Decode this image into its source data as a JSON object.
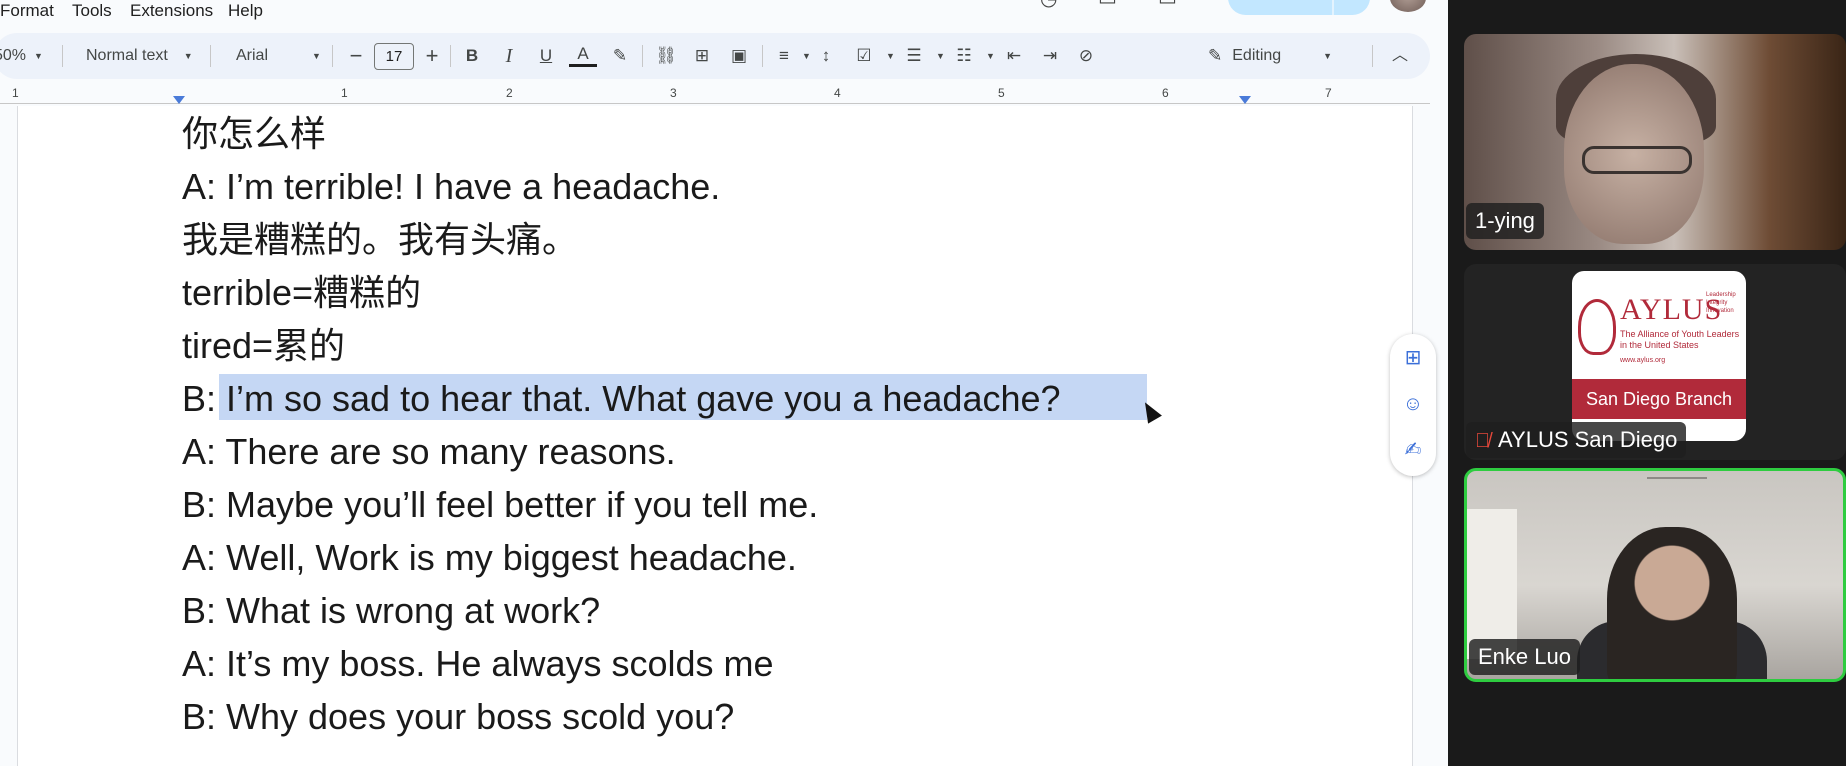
{
  "menubar": {
    "items": [
      "Format",
      "Tools",
      "Extensions",
      "Help"
    ]
  },
  "toolbar": {
    "zoom": "50%",
    "style": "Normal text",
    "font": "Arial",
    "font_size": "17",
    "mode": "Editing",
    "icons": [
      "decrease-font-icon",
      "increase-font-icon",
      "bold-icon",
      "italic-icon",
      "underline-icon",
      "text-color-icon",
      "highlight-icon",
      "link-icon",
      "add-comment-icon",
      "insert-image-icon",
      "align-icon",
      "line-spacing-icon",
      "checklist-icon",
      "bullet-list-icon",
      "numbered-list-icon",
      "decrease-indent-icon",
      "increase-indent-icon",
      "clear-formatting-icon",
      "pencil-icon",
      "collapse-icon"
    ]
  },
  "ruler": {
    "numbers": [
      "1",
      "1",
      "2",
      "3",
      "4",
      "5",
      "6",
      "7"
    ]
  },
  "document": {
    "lines": [
      "你怎么样",
      "A: I’m terrible! I have a headache.",
      "我是糟糕的。我有头痛。",
      "terrible=糟糕的",
      "tired=累的",
      "B: I’m so sad to hear that. What gave you a headache?",
      "A: There are so many reasons.",
      "B: Maybe you’ll feel better if you tell me.",
      "A: Well, Work is my biggest headache.",
      "B: What is wrong at work?",
      "A: It’s my boss. He always scolds me",
      "B: Why does your boss scold you?"
    ],
    "selected_line_index": 5,
    "selection_color": "#c5d7f4"
  },
  "side_actions": [
    "add-comment-icon",
    "emoji-reaction-icon",
    "suggest-edits-icon"
  ],
  "gallery": {
    "participants": [
      {
        "name": "1-ying",
        "muted": false
      },
      {
        "name": "AYLUS San Diego",
        "muted": true
      },
      {
        "name": "Enke Luo",
        "muted": false,
        "active_speaker": true
      }
    ],
    "aylus_logo": {
      "brand": "AYLUS",
      "tagline": [
        "Leadership",
        "Integrity",
        "Innovation"
      ],
      "full_name": "The Alliance of Youth Leaders in the United States",
      "url": "www.aylus.org",
      "branch": "San Diego Branch"
    },
    "active_speaker_color": "#2ecc40"
  }
}
